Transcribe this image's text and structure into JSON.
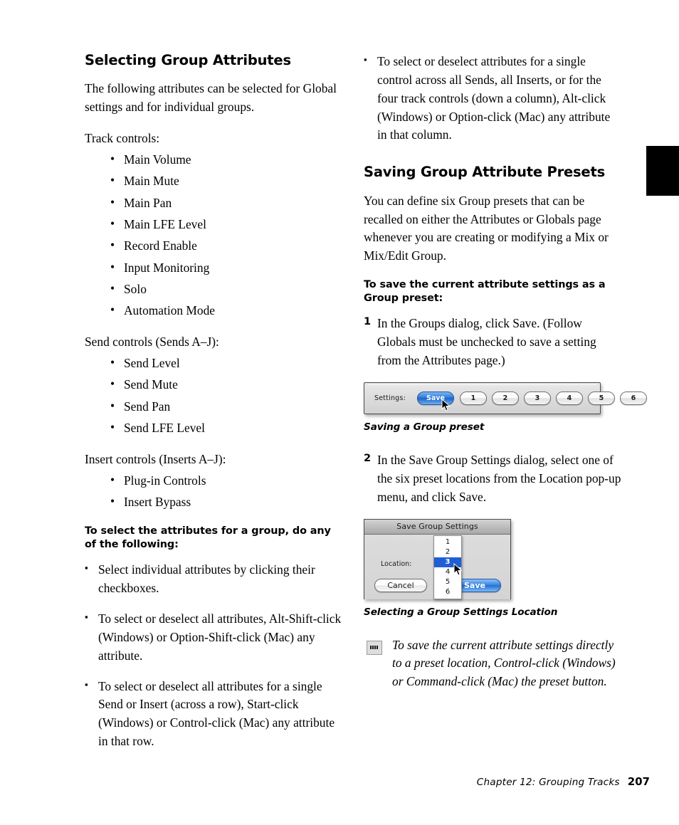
{
  "page": {
    "number": "207",
    "chapter": "Chapter 12: Grouping Tracks",
    "tab_color": "#000000"
  },
  "left_column": {
    "heading": "Selecting Group Attributes",
    "intro": "The following attributes can be selected for Global settings and for individual groups.",
    "track_controls_label": "Track controls:",
    "track_controls": [
      "Main Volume",
      "Main Mute",
      "Main Pan",
      "Main LFE Level",
      "Record Enable",
      "Input Monitoring",
      "Solo",
      "Automation Mode"
    ],
    "send_controls_label": "Send controls (Sends A–J):",
    "send_controls": [
      "Send Level",
      "Send Mute",
      "Send Pan",
      "Send LFE Level"
    ],
    "insert_controls_label": "Insert controls (Inserts A–J):",
    "insert_controls": [
      "Plug-in Controls",
      "Insert Bypass"
    ],
    "procedure_heading": "To select the attributes for a group, do any of the following:",
    "items": [
      "Select individual attributes by clicking their checkboxes.",
      "To select or deselect all attributes, Alt-Shift-click (Windows) or Option-Shift-click (Mac) any attribute.",
      "To select or deselect all attributes for a single Send or Insert (across a row), Start-click (Windows) or Control-click (Mac) any attribute in that row."
    ]
  },
  "right_column": {
    "continued_item": "To select or deselect attributes for a single control across all Sends, all Inserts, or for the four track controls (down a column), Alt-click (Windows) or Option-click (Mac) any attribute in that column.",
    "heading": "Saving Group Attribute Presets",
    "intro": "You can define six Group presets that can be recalled on either the Attributes or Globals page whenever you are creating or modifying a Mix or Mix/Edit Group.",
    "procedure_heading": "To save the current attribute settings as a Group preset:",
    "step1_num": "1",
    "step1_text": "In the Groups dialog, click Save. (Follow Globals must be unchecked to save a setting from the Attributes page.)",
    "figure1": {
      "settings_label": "Settings:",
      "save_button": "Save",
      "presets": [
        "1",
        "2",
        "3",
        "4",
        "5",
        "6"
      ],
      "caption": "Saving a Group preset"
    },
    "step2_num": "2",
    "step2_text": "In the Save Group Settings dialog, select one of the six preset locations from the Location pop-up menu, and click Save.",
    "figure2": {
      "title": "Save Group Settings",
      "location_label": "Location:",
      "cancel_button": "Cancel",
      "save_button": "Save",
      "options": [
        "1",
        "2",
        "3",
        "4",
        "5",
        "6"
      ],
      "selected_option": "3",
      "caption": "Selecting a Group Settings Location"
    },
    "tip": "To save the current attribute settings directly to a preset location, Control-click (Windows) or Command-click (Mac) the preset button."
  }
}
